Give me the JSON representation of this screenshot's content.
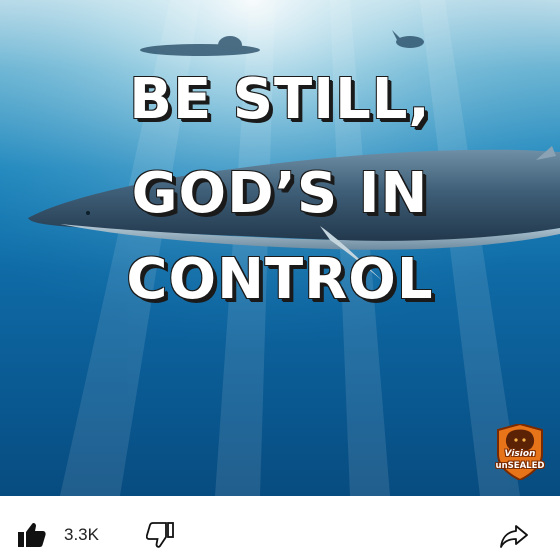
{
  "media": {
    "caption_line_1": "BE STILL,",
    "caption_line_2": "GOD’S IN",
    "caption_line_3": "CONTROL",
    "logo_line_1": "Vision",
    "logo_line_2": "unSEALED"
  },
  "actions": {
    "like_count": "3.3K",
    "like_icon": "thumbs-up-icon",
    "dislike_icon": "thumbs-down-icon",
    "share_icon": "share-arrow-icon"
  },
  "colors": {
    "water_top": "#cfe6ee",
    "water_deep": "#074c80",
    "caption_text": "#ffffff",
    "logo_orange": "#e8741a",
    "action_bar": "#ffffff"
  }
}
